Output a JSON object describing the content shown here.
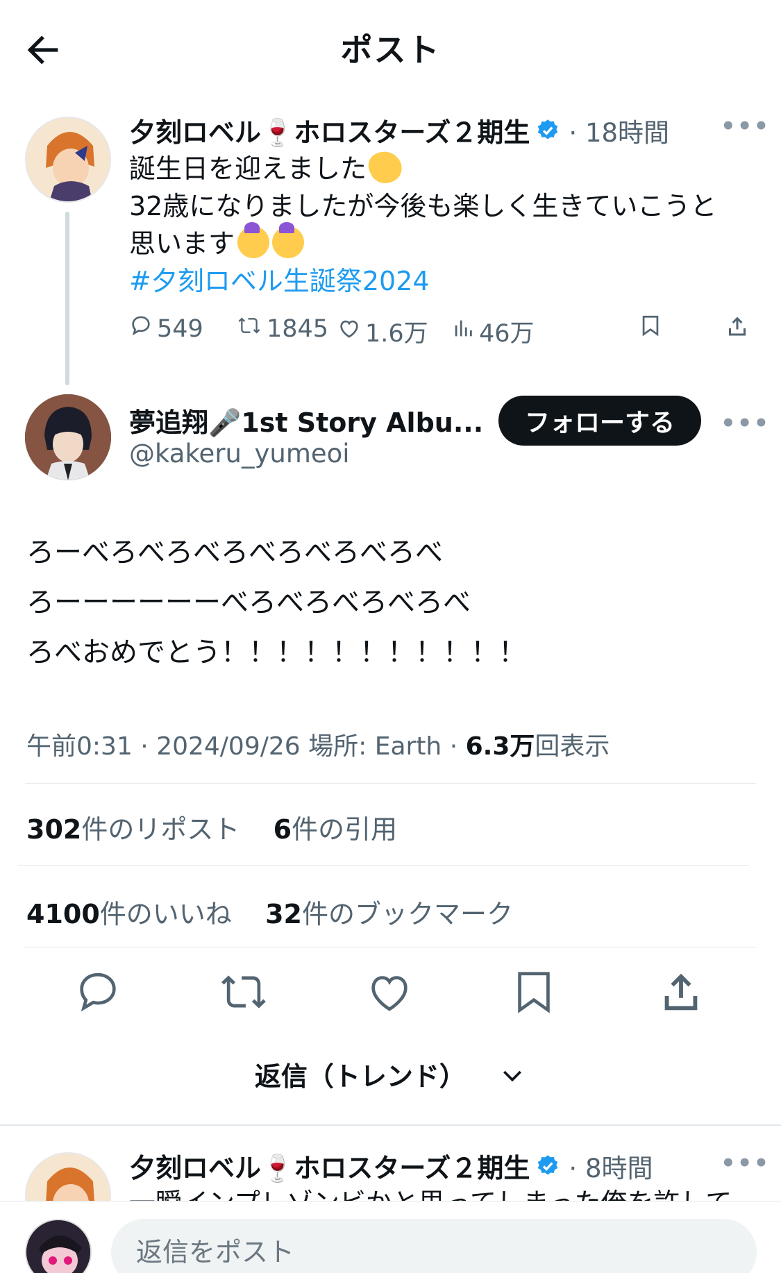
{
  "header": {
    "title": "ポスト"
  },
  "parent_post": {
    "display_name": "夕刻ロベル🍷ホロスターズ２期生",
    "time": "18時間",
    "text_lines": [
      "誕生日を迎えました",
      "32歳になりましたが今後も楽しく生きていこうと",
      "思います"
    ],
    "hashtag": "#夕刻ロベル生誕祭2024",
    "replies": "549",
    "reposts": "1845",
    "likes": "1.6万",
    "views": "46万"
  },
  "main_post": {
    "display_name": "夢追翔🎤1st Story Albu...",
    "handle": "@kakeru_yumeoi",
    "follow_label": "フォローする",
    "text": "ろーべろべろべろべろべろべろべ\nろーーーーーーべろべろべろべろべ\nろべおめでとう！！！！！！！！！！！",
    "time": "午前0:31",
    "date": "2024/09/26",
    "place_label": "場所: Earth",
    "views_count": "6.3万",
    "views_label": "回表示"
  },
  "stats": {
    "reposts_count": "302",
    "reposts_label": "件のリポスト",
    "quotes_count": "6",
    "quotes_label": "件の引用",
    "likes_count": "4100",
    "likes_label": "件のいいね",
    "bookmarks_count": "32",
    "bookmarks_label": "件のブックマーク"
  },
  "replies_sort": {
    "label": "返信（トレンド）"
  },
  "reply_preview": {
    "display_name": "夕刻ロベル🍷ホロスターズ２期生",
    "time": "8時間",
    "text": "一瞬インプレゾンビかと思ってしまった俺を許して"
  },
  "composer": {
    "placeholder": "返信をポスト"
  },
  "colors": {
    "accent": "#1d9bf0",
    "text": "#0f1419",
    "muted": "#536471",
    "button_dark": "#0f1419"
  },
  "icons": [
    "back-arrow-icon",
    "verified-icon",
    "more-icon",
    "reply-icon",
    "repost-icon",
    "like-icon",
    "views-icon",
    "bookmark-icon",
    "share-icon",
    "chevron-down-icon"
  ]
}
